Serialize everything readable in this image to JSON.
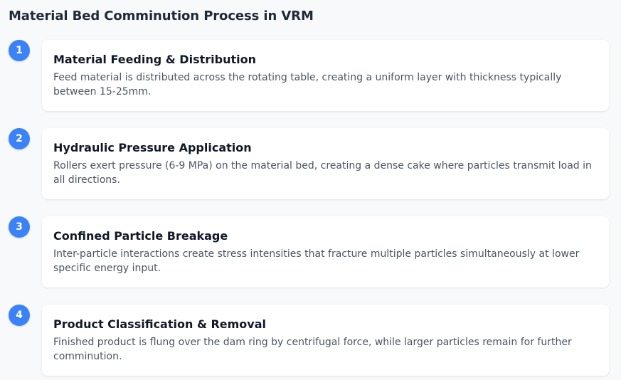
{
  "title": "Material Bed Comminution Process in VRM",
  "accent_color": "#3b82f6",
  "steps": [
    {
      "number": "1",
      "title": "Material Feeding & Distribution",
      "description": "Feed material is distributed across the rotating table, creating a uniform layer with thickness typically between 15-25mm."
    },
    {
      "number": "2",
      "title": "Hydraulic Pressure Application",
      "description": "Rollers exert pressure (6-9 MPa) on the material bed, creating a dense cake where particles transmit load in all directions."
    },
    {
      "number": "3",
      "title": "Confined Particle Breakage",
      "description": "Inter-particle interactions create stress intensities that fracture multiple particles simultaneously at lower specific energy input."
    },
    {
      "number": "4",
      "title": "Product Classification & Removal",
      "description": "Finished product is flung over the dam ring by centrifugal force, while larger particles remain for further comminution."
    }
  ]
}
